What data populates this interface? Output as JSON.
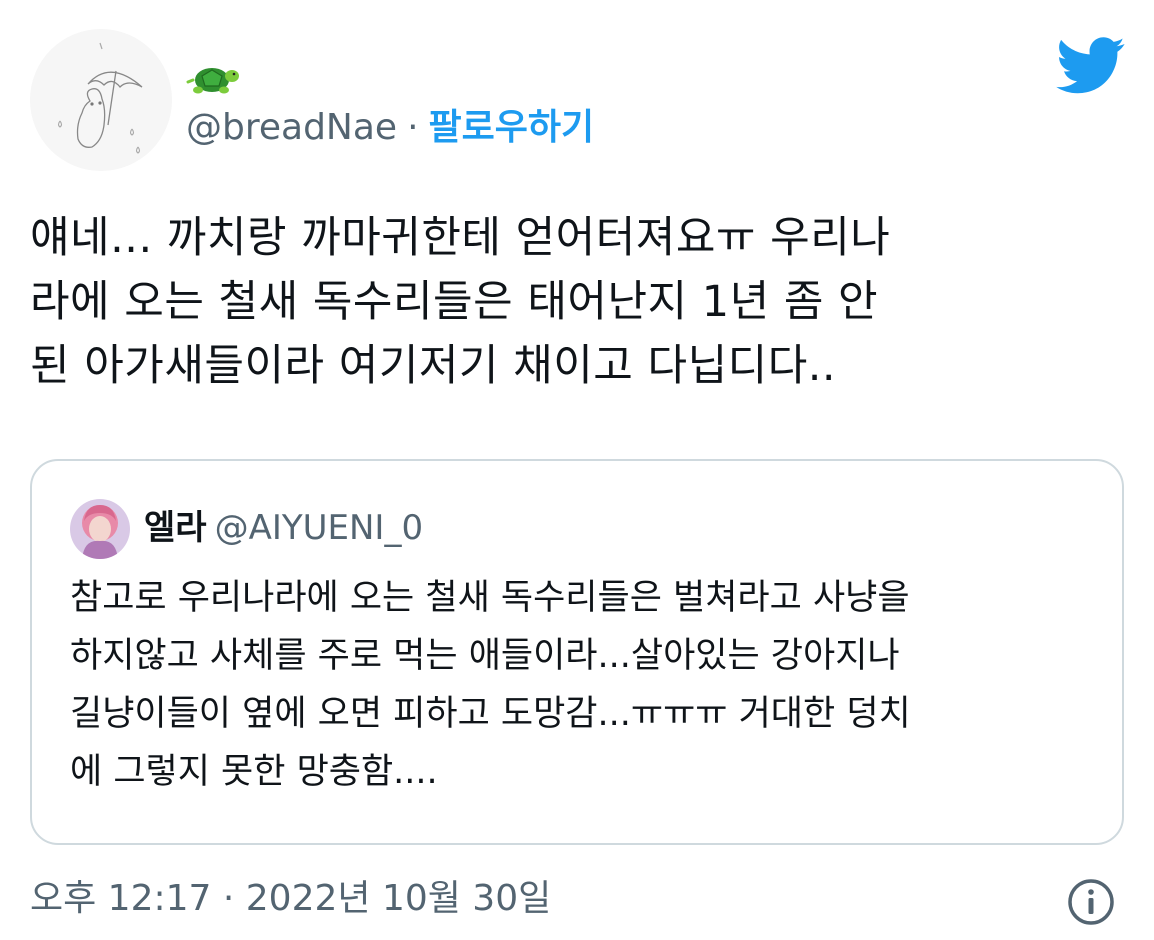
{
  "author": {
    "name_emoji": "🐢",
    "handle": "@breadNae",
    "separator": "·",
    "follow_label": "팔로우하기"
  },
  "tweet": {
    "text": "얘네... 까치랑 까마귀한테 얻어터져요ㅠ 우리나\n라에 오는 철새 독수리들은 태어난지 1년 좀 안\n된 아가새들이라 여기저기 채이고 다닙디다.."
  },
  "quoted": {
    "name": "엘라",
    "handle": "@AIYUENI_0",
    "text": "참고로 우리나라에 오는 철새 독수리들은 벌쳐라고 사냥을\n하지않고 사체를 주로 먹는 애들이라...살아있는 강아지나\n길냥이들이 옆에 오면 피하고 도망감...ㅠㅠㅠ 거대한 덩치\n에 그렇지 못한 망충함...."
  },
  "timestamp": "오후 12:17 · 2022년 10월 30일",
  "colors": {
    "accent": "#1d9bf0",
    "secondary_text": "#536471",
    "border": "#cfd9de"
  },
  "icons": {
    "brand": "twitter-bird-icon",
    "info": "info-icon",
    "name_emoji": "turtle-emoji-icon"
  }
}
